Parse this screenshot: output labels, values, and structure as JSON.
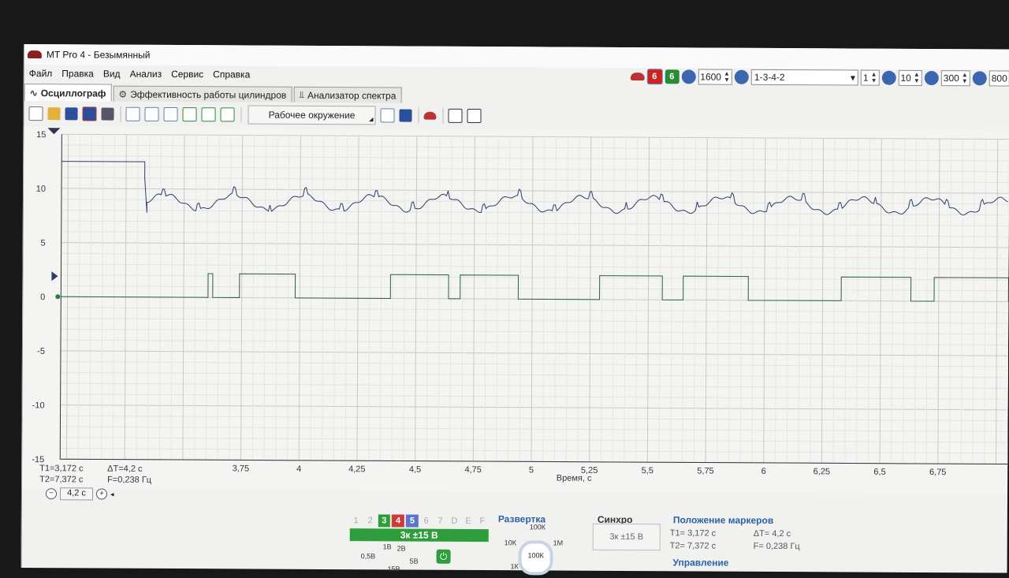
{
  "window": {
    "title": "MT Pro 4 - Безымянный"
  },
  "menu": [
    "Файл",
    "Правка",
    "Вид",
    "Анализ",
    "Сервис",
    "Справка"
  ],
  "right_toolbar": {
    "rpm": "1600",
    "firing_order": "1-3-4-2",
    "cylinder": "1",
    "timing": "10",
    "value_300": "300",
    "value_800": "800"
  },
  "tabs": [
    {
      "label": "Осциллограф",
      "active": true
    },
    {
      "label": "Эффективность работы цилиндров",
      "active": false
    },
    {
      "label": "Анализатор спектра",
      "active": false
    }
  ],
  "toolbar": {
    "environment": "Рабочее окружение"
  },
  "plot": {
    "y_ticks": [
      "15",
      "10",
      "5",
      "0",
      "-5",
      "-10",
      "-15"
    ],
    "x_ticks": [
      "3,75",
      "4",
      "4,25",
      "4,5",
      "4,75",
      "5",
      "5,25",
      "5,5",
      "5,75",
      "6",
      "6,25",
      "6,5",
      "6,75"
    ],
    "x_label": "Время, с"
  },
  "readouts": {
    "t1": "T1=3,172 с",
    "dt": "ΔT=4,2 с",
    "t2": "T2=7,372 с",
    "freq": "F=0,238 Гц",
    "zoom": "4,2 с"
  },
  "bottom": {
    "channels": [
      "1",
      "2",
      "3",
      "4",
      "5",
      "6",
      "7",
      "D",
      "E",
      "F"
    ],
    "channel_bar": "3к ±15 В",
    "volt_labels": [
      "0,5В",
      "1В",
      "2В",
      "5В",
      "15В"
    ],
    "sweep_title": "Развертка",
    "sweep_labels": [
      "10К",
      "100К",
      "1М",
      "1К",
      "100К"
    ],
    "sync_title": "Синхро",
    "sync_value": "3к ±15 В",
    "markers_title": "Положение маркеров",
    "markers": {
      "t1": "T1= 3,172 с",
      "dt": "ΔT= 4,2 с",
      "t2": "T2= 7,372 с",
      "f": "F= 0,238 Гц"
    },
    "control_title": "Управление"
  },
  "colors": {
    "signal_blue": "#2a3d6b",
    "signal_green": "#2e5e3a",
    "accent_green": "#2e9e3c",
    "title_blue": "#2e62a8"
  }
}
